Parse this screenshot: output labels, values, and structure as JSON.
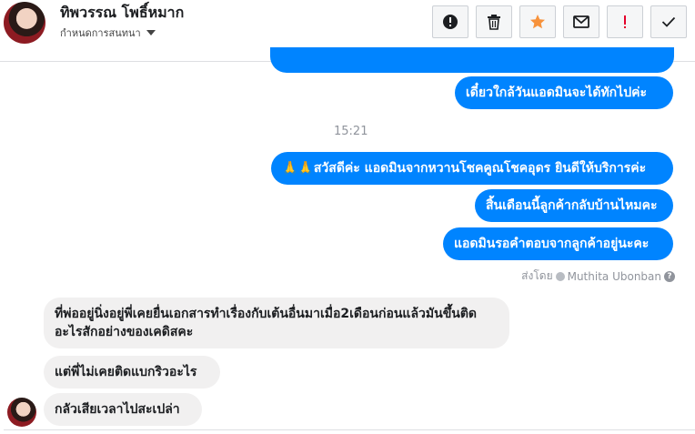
{
  "header": {
    "contact_name": "ทิพวรรณ โพธิ์หมาก",
    "subtitle": "กำหนดการสนทนา",
    "buttons": [
      {
        "name": "report-button",
        "icon": "exclamation-circle-icon"
      },
      {
        "name": "delete-button",
        "icon": "trash-icon"
      },
      {
        "name": "star-button",
        "icon": "star-icon",
        "color": "#f7923b"
      },
      {
        "name": "mark-unread-button",
        "icon": "envelope-icon"
      },
      {
        "name": "flag-spam-button",
        "icon": "exclamation-icon",
        "color": "#e4002b"
      },
      {
        "name": "mark-done-button",
        "icon": "checkmark-icon"
      }
    ]
  },
  "messages": {
    "out_1": "เดี๋ยวใกล้วันแอดมินจะได้ทักไปค่ะ",
    "timestamp": "15:21",
    "out_2": "🙏🙏สวัสดีค่ะ แอดมินจากหวานโชคคูณโชคอุดร ยินดีให้บริการค่ะ",
    "out_3": "สิ้นเดือนนี้ลูกค้ากลับบ้านไหมคะ",
    "out_4": "แอดมินรอคำตอบจากลูกค้าอยู่นะคะ",
    "sent_by_label": "ส่งโดย",
    "sent_by_name": "Muthita Ubonban",
    "in_1": "ที่พ่ออยู่นิ่งอยู่พี่เคยยื่นเอกสารทำเรื่องกับเต้นอื่นมาเมื่อ2เดือนก่อนแล้วมันขึ้นติดอะไรสักอย่างของเคดิสคะ",
    "in_2": "แต่พี่ไม่เคยติดแบกริวอะไร",
    "in_3": "กลัวเสียเวลาไปสะเปล่า"
  },
  "colors": {
    "outgoing_bubble": "#0084ff",
    "incoming_bubble": "#f1f0f0"
  }
}
